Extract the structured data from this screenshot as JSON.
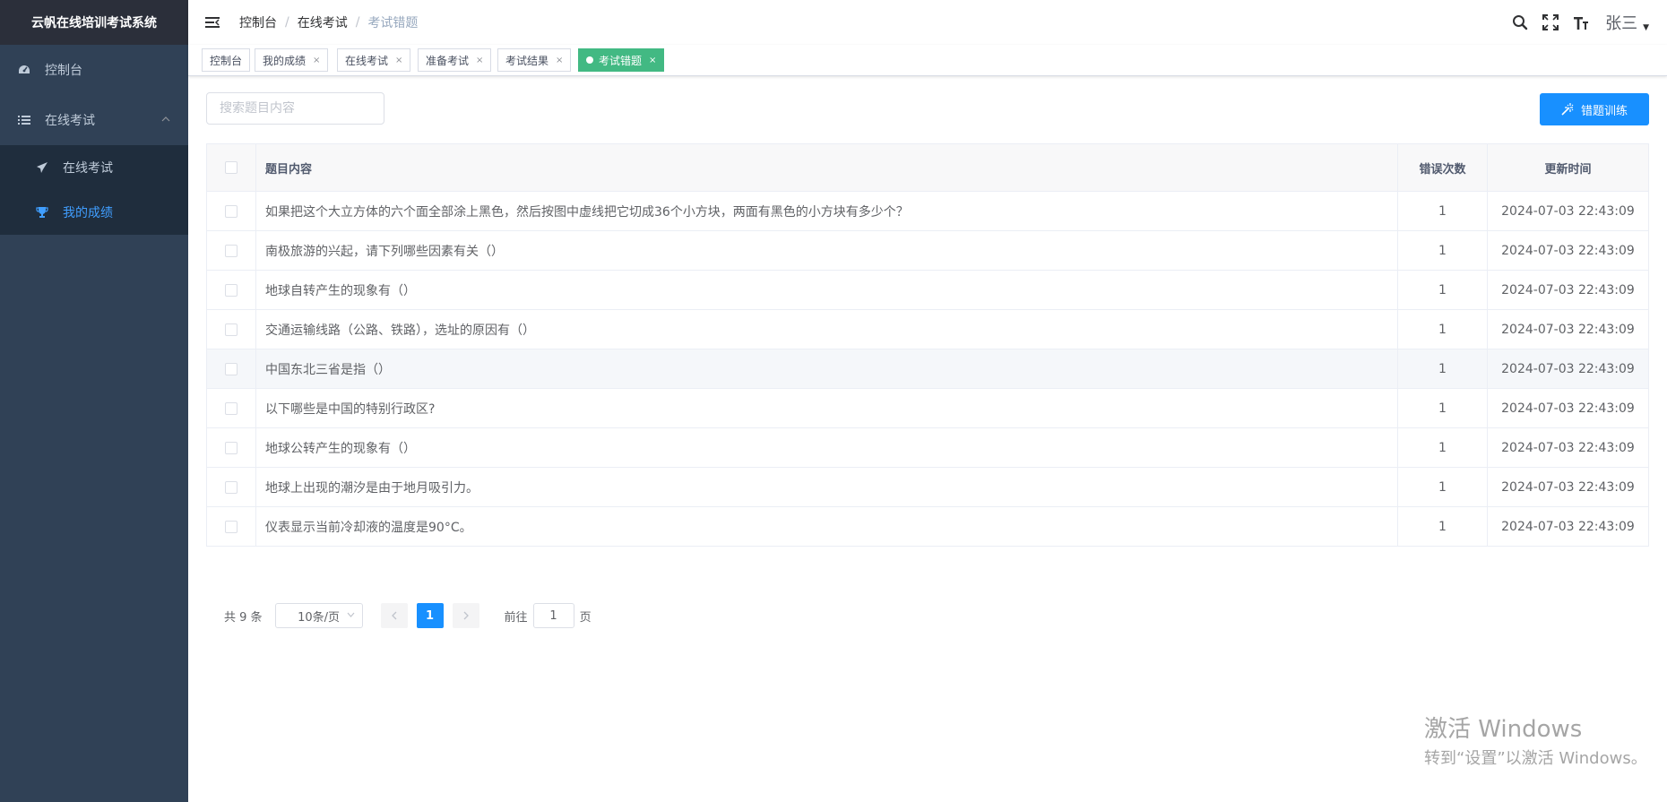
{
  "app": {
    "title": "云帆在线培训考试系统"
  },
  "sidebar": {
    "items": [
      {
        "label": "控制台",
        "icon": "dashboard-icon"
      },
      {
        "label": "在线考试",
        "icon": "list-icon",
        "expanded": true,
        "children": [
          {
            "label": "在线考试",
            "icon": "paper-plane-icon"
          },
          {
            "label": "我的成绩",
            "icon": "trophy-icon",
            "active": true
          }
        ]
      }
    ]
  },
  "breadcrumb": [
    "控制台",
    "在线考试",
    "考试错题"
  ],
  "header": {
    "username": "张三"
  },
  "tags": [
    {
      "label": "控制台",
      "closable": false
    },
    {
      "label": "我的成绩",
      "closable": true
    },
    {
      "label": "在线考试",
      "closable": true
    },
    {
      "label": "准备考试",
      "closable": true
    },
    {
      "label": "考试结果",
      "closable": true
    },
    {
      "label": "考试错题",
      "closable": true,
      "active": true
    }
  ],
  "tag_close": "×",
  "search": {
    "placeholder": "搜索题目内容",
    "value": ""
  },
  "train_button": {
    "label": "错题训练"
  },
  "table": {
    "columns": {
      "content": "题目内容",
      "count": "错误次数",
      "time": "更新时间"
    },
    "rows": [
      {
        "content": "如果把这个大立方体的六个面全部涂上黑色，然后按图中虚线把它切成36个小方块，两面有黑色的小方块有多少个？",
        "count": "1",
        "time": "2024-07-03 22:43:09"
      },
      {
        "content": "南极旅游的兴起，请下列哪些因素有关（）",
        "count": "1",
        "time": "2024-07-03 22:43:09"
      },
      {
        "content": "地球自转产生的现象有（）",
        "count": "1",
        "time": "2024-07-03 22:43:09"
      },
      {
        "content": "交通运输线路（公路、铁路），选址的原因有（）",
        "count": "1",
        "time": "2024-07-03 22:43:09"
      },
      {
        "content": "中国东北三省是指（）",
        "count": "1",
        "time": "2024-07-03 22:43:09"
      },
      {
        "content": "以下哪些是中国的特别行政区?",
        "count": "1",
        "time": "2024-07-03 22:43:09"
      },
      {
        "content": "地球公转产生的现象有（）",
        "count": "1",
        "time": "2024-07-03 22:43:09"
      },
      {
        "content": "地球上出现的潮汐是由于地月吸引力。",
        "count": "1",
        "time": "2024-07-03 22:43:09"
      },
      {
        "content": "仪表显示当前冷却液的温度是90°C。",
        "count": "1",
        "time": "2024-07-03 22:43:09"
      }
    ]
  },
  "pagination": {
    "total_text": "共 9 条",
    "page_size": "10条/页",
    "current_page": "1",
    "goto_prefix": "前往",
    "goto_value": "1",
    "goto_suffix": "页"
  },
  "watermark": {
    "line1": "激活 Windows",
    "line2": "转到“设置”以激活 Windows。"
  },
  "colors": {
    "sidebar_bg": "#304156",
    "accent": "#1890ff",
    "active_tag": "#42b983",
    "active_menu_text": "#409eff"
  }
}
